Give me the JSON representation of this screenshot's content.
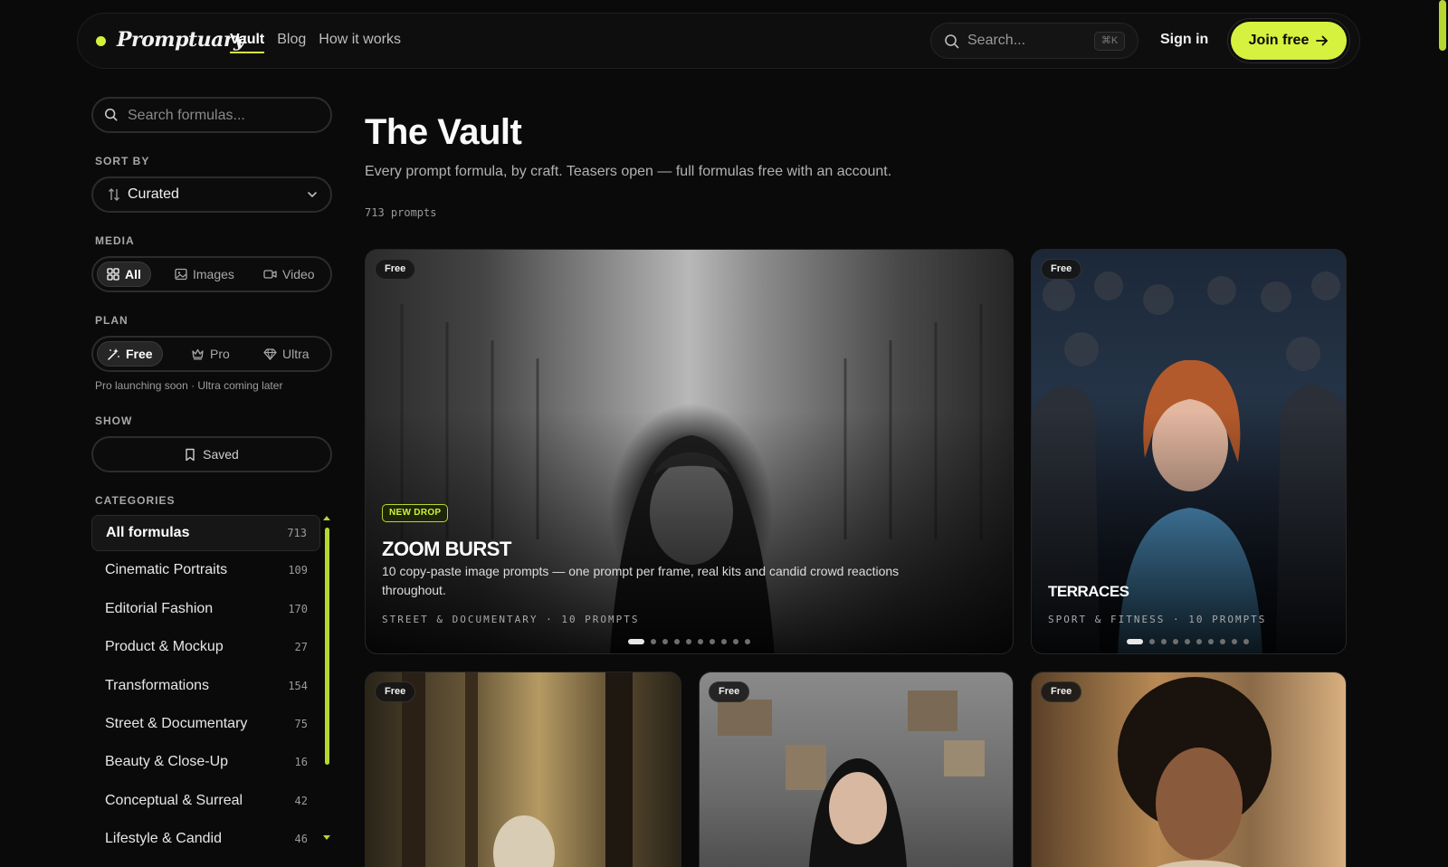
{
  "nav": {
    "logo": "Promptuary",
    "links": [
      "Vault",
      "Blog",
      "How it works"
    ],
    "search_placeholder": "Search...",
    "search_shortcut": "⌘K",
    "signin": "Sign in",
    "join": "Join free"
  },
  "sidebar": {
    "search_placeholder": "Search formulas...",
    "sort_label": "SORT BY",
    "sort_value": "Curated",
    "media_label": "MEDIA",
    "media_options": [
      "All",
      "Images",
      "Video"
    ],
    "plan_label": "PLAN",
    "plan_options": [
      "Free",
      "Pro",
      "Ultra"
    ],
    "plan_note": "Pro launching soon · Ultra coming later",
    "show_label": "SHOW",
    "saved_label": "Saved",
    "categories_label": "CATEGORIES",
    "categories": [
      {
        "name": "All formulas",
        "count": "713"
      },
      {
        "name": "Cinematic Portraits",
        "count": "109"
      },
      {
        "name": "Editorial Fashion",
        "count": "170"
      },
      {
        "name": "Product & Mockup",
        "count": "27"
      },
      {
        "name": "Transformations",
        "count": "154"
      },
      {
        "name": "Street & Documentary",
        "count": "75"
      },
      {
        "name": "Beauty & Close-Up",
        "count": "16"
      },
      {
        "name": "Conceptual & Surreal",
        "count": "42"
      },
      {
        "name": "Lifestyle & Candid",
        "count": "46"
      }
    ]
  },
  "main": {
    "title": "The Vault",
    "subtitle": "Every prompt formula, by craft. Teasers open — full formulas free with an account.",
    "count": "713 prompts",
    "cards": [
      {
        "badge": "Free",
        "tag": "NEW DROP",
        "title": "ZOOM BURST",
        "desc": "10 copy-paste image prompts — one prompt per frame, real kits and candid crowd reactions throughout.",
        "meta": "STREET & DOCUMENTARY · 10 PROMPTS",
        "slides": 10
      },
      {
        "badge": "Free",
        "title": "TERRACES",
        "meta": "SPORT & FITNESS · 10 PROMPTS",
        "slides": 10
      },
      {
        "badge": "Free"
      },
      {
        "badge": "Free"
      },
      {
        "badge": "Free"
      }
    ]
  },
  "colors": {
    "accent": "#d6f23f",
    "background": "#0a0a0a"
  }
}
